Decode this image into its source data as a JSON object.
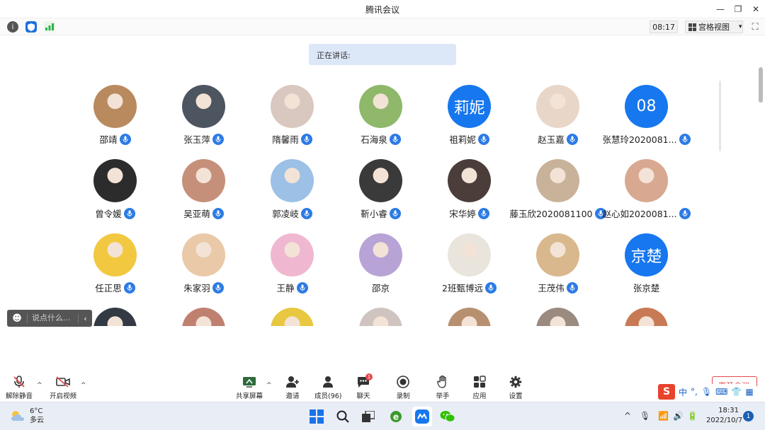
{
  "window": {
    "title": "腾讯会议",
    "minimize": "—",
    "maximize": "❐",
    "close": "✕"
  },
  "toolbar": {
    "clock": "08:17",
    "view_mode": "宫格视图",
    "view_caret": "▾"
  },
  "speaking_label": "正在讲话:",
  "participants": [
    {
      "name": "邵靖",
      "avatar": "photo",
      "color": "#b98a5e"
    },
    {
      "name": "张玉萍",
      "avatar": "photo",
      "color": "#4d5560"
    },
    {
      "name": "隋馨雨",
      "avatar": "photo",
      "color": "#d9c8c0"
    },
    {
      "name": "石海泉",
      "avatar": "photo",
      "color": "#8fb86a"
    },
    {
      "name": "祖莉妮",
      "avatar": "莉妮",
      "color": "#1677ee"
    },
    {
      "name": "赵玉嘉",
      "avatar": "photo",
      "color": "#e8d6c8"
    },
    {
      "name": "张慧玲2020081...",
      "avatar": "08",
      "color": "#1677ee"
    },
    {
      "name": "曾令媛",
      "avatar": "photo",
      "color": "#2c2c2c"
    },
    {
      "name": "吴亚萌",
      "avatar": "photo",
      "color": "#c58f7a"
    },
    {
      "name": "郭凌岐",
      "avatar": "photo",
      "color": "#9cc0e6"
    },
    {
      "name": "靳小睿",
      "avatar": "photo",
      "color": "#3a3a3a"
    },
    {
      "name": "宋华婷",
      "avatar": "photo",
      "color": "#4a3d3a"
    },
    {
      "name": "藤玉欣2020081100",
      "avatar": "photo",
      "color": "#c9b29a"
    },
    {
      "name": "赵心如2020081...",
      "avatar": "photo",
      "color": "#d8a890"
    },
    {
      "name": "任正思",
      "avatar": "photo",
      "color": "#f2c840"
    },
    {
      "name": "朱家羽",
      "avatar": "photo",
      "color": "#e9c9a8"
    },
    {
      "name": "王静",
      "avatar": "photo",
      "color": "#f0b8d0"
    },
    {
      "name": "邵京",
      "avatar": "photo",
      "color": "#b8a3d6",
      "no_mic": true
    },
    {
      "name": "2班甄博远",
      "avatar": "photo",
      "color": "#e9e4dc"
    },
    {
      "name": "王茂伟",
      "avatar": "photo",
      "color": "#d8b88c"
    },
    {
      "name": "张京楚",
      "avatar": "京楚",
      "color": "#1677ee",
      "no_mic": true
    },
    {
      "name": "",
      "avatar": "photo",
      "color": "#333a44"
    },
    {
      "name": "",
      "avatar": "photo",
      "color": "#c08070"
    },
    {
      "name": "",
      "avatar": "photo",
      "color": "#e8c840"
    },
    {
      "name": "",
      "avatar": "photo",
      "color": "#d0c4c0"
    },
    {
      "name": "",
      "avatar": "photo",
      "color": "#b79070"
    },
    {
      "name": "",
      "avatar": "photo",
      "color": "#9a8a80"
    },
    {
      "name": "",
      "avatar": "photo",
      "color": "#c87a55"
    }
  ],
  "chat": {
    "placeholder": "说点什么...",
    "collapse": "‹"
  },
  "meeting_bar": {
    "unmute": "解除静音",
    "start_video": "开启视频",
    "share_screen": "共享屏幕",
    "invite": "邀请",
    "members": "成员(96)",
    "chat": "聊天",
    "chat_badge": "1",
    "record": "录制",
    "raise_hand": "举手",
    "apps": "应用",
    "settings": "设置",
    "leave": "离开会议"
  },
  "ime": {
    "lang": "中",
    "punct": "°,"
  },
  "taskbar": {
    "temperature": "6°C",
    "weather": "多云",
    "time": "18:31",
    "date": "2022/10/7",
    "notifications": "1"
  },
  "colors": {
    "accent": "#1677ee",
    "mic": "#2c7be5",
    "danger": "#e5484d"
  }
}
